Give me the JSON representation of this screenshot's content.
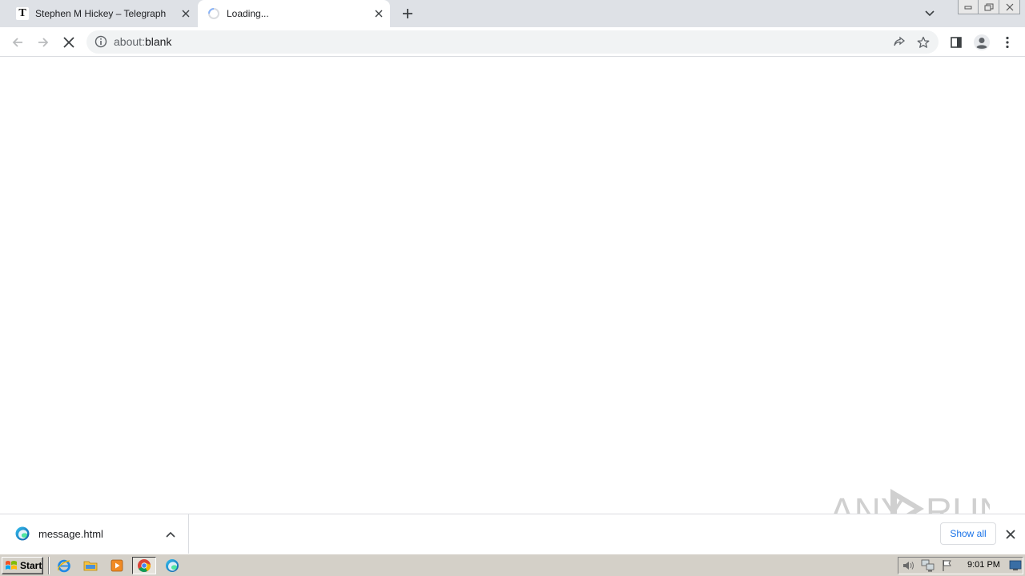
{
  "browser": {
    "tabs": [
      {
        "title": "Stephen M Hickey – Telegraph",
        "favicon": "telegraph-t-icon",
        "active": false
      },
      {
        "title": "Loading...",
        "favicon": "loading-spinner-icon",
        "active": true
      }
    ],
    "favicon_letter": "T",
    "toolbar": {
      "url_scheme": "about:",
      "url_rest": "blank"
    }
  },
  "download_shelf": {
    "items": [
      {
        "filename": "message.html",
        "icon": "edge-file-icon"
      }
    ],
    "show_all_label": "Show all"
  },
  "watermark": {
    "text_left": "ANY",
    "text_right": "RUN"
  },
  "taskbar": {
    "start_label": "Start",
    "clock": "9:01 PM"
  },
  "colors": {
    "accent": "#1a73e8",
    "tabstrip_bg": "#dee1e6",
    "omnibox_bg": "#f1f3f4",
    "taskbar_bg": "#d4d0c8"
  }
}
